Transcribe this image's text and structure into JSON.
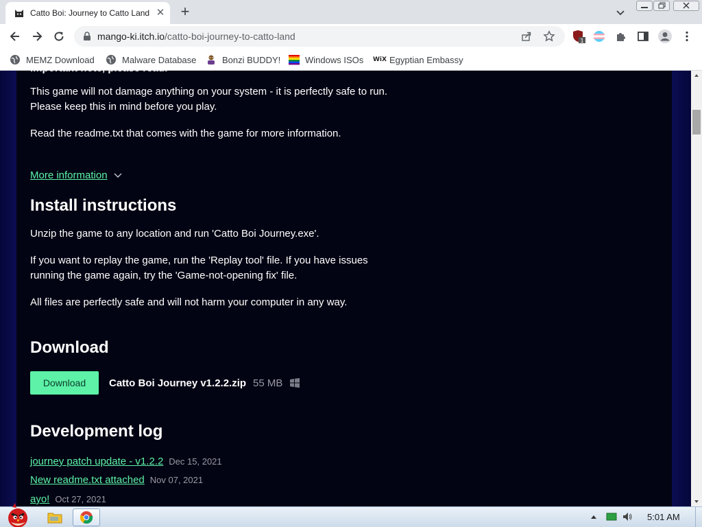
{
  "browser": {
    "tab_title": "Catto Boi: Journey to Catto Land",
    "url_host": "mango-ki.itch.io",
    "url_path": "/catto-boi-journey-to-catto-land",
    "extension_badge": "1"
  },
  "bookmarks": [
    {
      "label": "MEMZ Download",
      "icon": "globe-icon"
    },
    {
      "label": "Malware Database",
      "icon": "globe-icon"
    },
    {
      "label": "Bonzi BUDDY!",
      "icon": "bonzi-icon"
    },
    {
      "label": "Windows ISOs",
      "icon": "rainbow-flag-icon"
    },
    {
      "label": "Egyptian Embassy",
      "icon": "wix-icon",
      "icon_text": "WiX"
    }
  ],
  "page": {
    "cut_heading": "Important note, please read:",
    "safety_note": "This game will not damage anything on your system - it is perfectly safe to run. Please keep this in mind before you play.",
    "readme_note": "Read the readme.txt that comes with the game for more information.",
    "more_info": "More information",
    "install_heading": "Install instructions",
    "install_p1": "Unzip the game to any location and run 'Catto Boi Journey.exe'.",
    "install_p2": "If you want to replay the game, run the 'Replay tool' file. If you have issues running the game again, try the 'Game-not-opening fix' file.",
    "install_p3": "All files are perfectly safe and will not harm your computer in any way.",
    "download_heading": "Download",
    "download_button": "Download",
    "file_name": "Catto Boi Journey v1.2.2.zip",
    "file_size": "55 MB",
    "devlog_heading": "Development log",
    "devlog": [
      {
        "title": "journey patch update - v1.2.2",
        "date": "Dec 15, 2021"
      },
      {
        "title": "New readme.txt attached",
        "date": "Nov 07, 2021"
      },
      {
        "title": "ayo!",
        "date": "Oct 27, 2021"
      }
    ]
  },
  "colors": {
    "accent_green": "#5df2a7",
    "page_bg": "#030413",
    "side_gradient": "#0b0d52"
  },
  "taskbar": {
    "clock": "5:01 AM"
  }
}
